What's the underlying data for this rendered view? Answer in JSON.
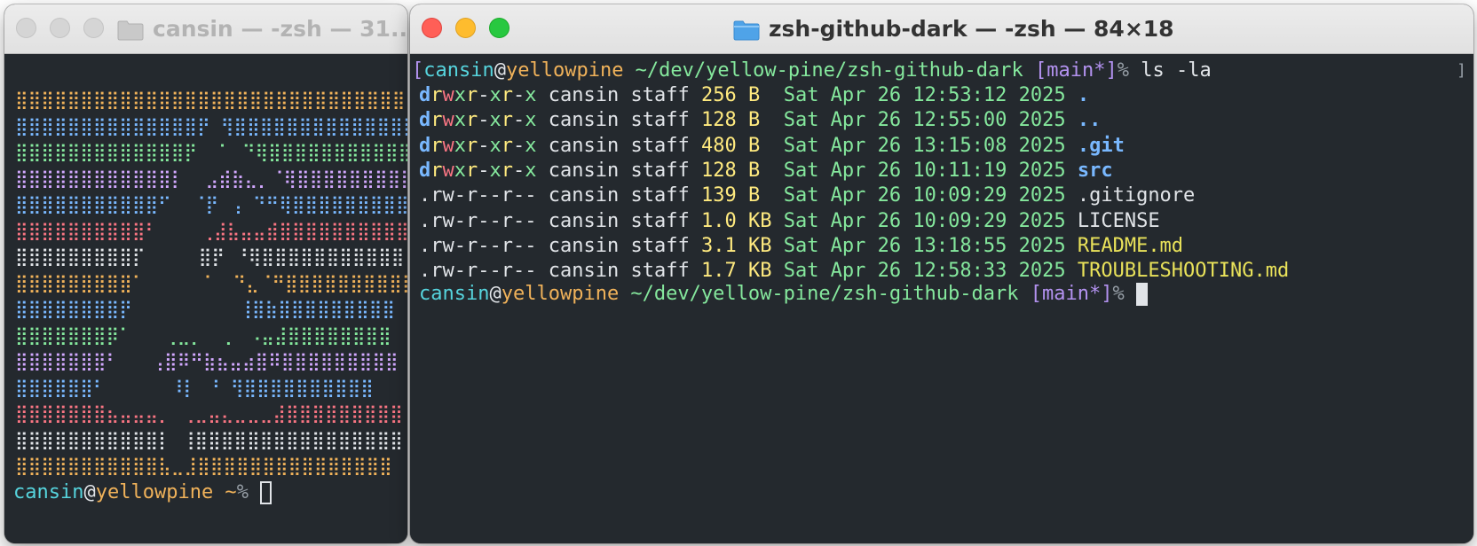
{
  "left_window": {
    "title": "cansin — -zsh — 31...",
    "ascii_art": {
      "rows": [
        "⣿⣿⣿⣿⣿⣿⣿⣿⣿⣿⣿⣿⣿⣿⣿⣿⣿⣿⣿⣿⣿⣿⣿⣿⣿⣿⣿⣿⣿⣿⣿⣿",
        "⣿⣿⣿⣿⣿⣿⣿⣿⣿⣿⣿⣿⣿⣿⡟ ⢻⣿⣿⣿⣿⣿⣿⣿⣿⣿⣿⣿⣿⣿⣿⣿",
        "⣿⣿⣿⣿⣿⣿⣿⣿⣿⣿⣿⣿⣿⡟  ⠁ ⠙⢿⣿⣿⣿⣿⣿⣿⣿⣿⣿⣿⣿⣿",
        "⣿⣿⣿⣿⣿⣿⣿⣿⣿⣿⣿⣿⡇  ⣠⣾⣷⣄⡀⠈⢿⣿⣿⣿⣿⣿⣿⣿⣿⣿⣿",
        "⣿⣿⣿⣿⣿⣿⣿⣿⣿⣿⣿⠋  ⠈⡟ ⢠ ⠙⠛⢿⣿⣿⣿⣿⣿⣿⣿⣿⣿⣿",
        "⣿⣿⣿⣿⣿⣿⣿⣿⣿⣿⠃    ⢀⣼⣧⣤⣤⣾⣿⣿⣿⣿⣿⣿⣿⣿⣿⣿",
        "⣿⣿⣿⣿⣿⣿⣿⣿⣿⡏     ⣿⡟ ⠘⢿⣿⣿⣿⣿⣿⣿⣿⣿⣿⣿⣿",
        "⣿⣿⣿⣿⣿⣿⣿⣿⣿⠁     ⠈  ⠙⣄⠈⠛⣿⣿⣿⣿⣿⣿⣿⣿⣿⣿",
        "⣿⣿⣿⣿⣿⣿⣿⣿⡟          ⢸⣿⣷⣿⣿⣿⣿⣿⣿⣿⣿⣿",
        "⣿⣿⣿⣿⣿⣿⣿⡿⠁   ⢀⣀⡀  ⡀ ⠠⣤⣼⣿⣿⣿⣿⣿⣿⣿⣿",
        "⣿⣿⣿⣿⣿⣿⣿⠃   ⢠⣿⠿⠛⣷⣦⣤⣴⣿⠿⣿⣿⣿⣿⣿⣿⣿⣿⣿",
        "⣿⣿⣿⣿⣿⣿⠃      ⠸⡇ ⠘ ⢻⣿⣿⣿⣿⣿⣿⣿⣿⣿⣿",
        "⣿⣿⣿⣿⣿⣿⣿⣦⣤⣤⣤⡀ ⢀⣀⣤⣄⣀⣀⣀⣼⣿⣿⣿⣿⣿⣿⣿⣿⣿",
        "⣿⣿⣿⣿⣿⣿⣿⣿⣿⣿⣿⡇ ⢸⣿⣿⣿⣿⣿⣿⣿⣿⣿⣿⣿⣿⣿⣿⣿⣿",
        "⣿⣿⣿⣿⣿⣿⣿⣿⣿⣿⣿⣧⣀⣸⣿⣿⣿⣿⣿⣿⣿⣿⣿⣿⣿⣿⣿⣿⣿"
      ],
      "colors": [
        "#f0b25a",
        "#79b8ff",
        "#85e89d",
        "#d2a8ff",
        "#79b8ff",
        "#f97583",
        "#e1e4e8",
        "#f0b25a",
        "#79b8ff",
        "#85e89d",
        "#d2a8ff",
        "#79b8ff",
        "#f97583",
        "#e1e4e8",
        "#f0b25a"
      ]
    },
    "prompt": {
      "user": "cansin",
      "at": "@",
      "host": "yellowpine",
      "path": " ~",
      "symbol": "% "
    }
  },
  "right_window": {
    "title": "zsh-github-dark — -zsh — 84×18",
    "prompt1": {
      "open_bracket": "[",
      "user": "cansin",
      "at": "@",
      "host": "yellowpine",
      "path": " ~/dev/yellow-pine/zsh-github-dark ",
      "git": "[main*]",
      "symbol": "% ",
      "command": "ls -la"
    },
    "listing": [
      {
        "d": "d",
        "perms": "rwxr-xr-x",
        "owner": "cansin",
        "group": "staff",
        "size": "256 B ",
        "date": "Sat Apr 26 12:53:12 2025",
        "name": ".",
        "kind": "dir"
      },
      {
        "d": "d",
        "perms": "rwxr-xr-x",
        "owner": "cansin",
        "group": "staff",
        "size": "128 B ",
        "date": "Sat Apr 26 12:55:00 2025",
        "name": "..",
        "kind": "dir"
      },
      {
        "d": "d",
        "perms": "rwxr-xr-x",
        "owner": "cansin",
        "group": "staff",
        "size": "480 B ",
        "date": "Sat Apr 26 13:15:08 2025",
        "name": ".git",
        "kind": "dir"
      },
      {
        "d": "d",
        "perms": "rwxr-xr-x",
        "owner": "cansin",
        "group": "staff",
        "size": "128 B ",
        "date": "Sat Apr 26 10:11:19 2025",
        "name": "src",
        "kind": "dir"
      },
      {
        "d": ".",
        "perms": "rw-r--r--",
        "owner": "cansin",
        "group": "staff",
        "size": "139 B ",
        "date": "Sat Apr 26 10:09:29 2025",
        "name": ".gitignore",
        "kind": "file"
      },
      {
        "d": ".",
        "perms": "rw-r--r--",
        "owner": "cansin",
        "group": "staff",
        "size": "1.0 KB",
        "date": "Sat Apr 26 10:09:29 2025",
        "name": "LICENSE",
        "kind": "file"
      },
      {
        "d": ".",
        "perms": "rw-r--r--",
        "owner": "cansin",
        "group": "staff",
        "size": "3.1 KB",
        "date": "Sat Apr 26 13:18:55 2025",
        "name": "README.md",
        "kind": "doc"
      },
      {
        "d": ".",
        "perms": "rw-r--r--",
        "owner": "cansin",
        "group": "staff",
        "size": "1.7 KB",
        "date": "Sat Apr 26 12:58:33 2025",
        "name": "TROUBLESHOOTING.md",
        "kind": "doc"
      }
    ],
    "prompt2": {
      "user": "cansin",
      "at": "@",
      "host": "yellowpine",
      "path": " ~/dev/yellow-pine/zsh-github-dark ",
      "git": "[main*]",
      "symbol": "% "
    },
    "scroll_marker": "]"
  }
}
